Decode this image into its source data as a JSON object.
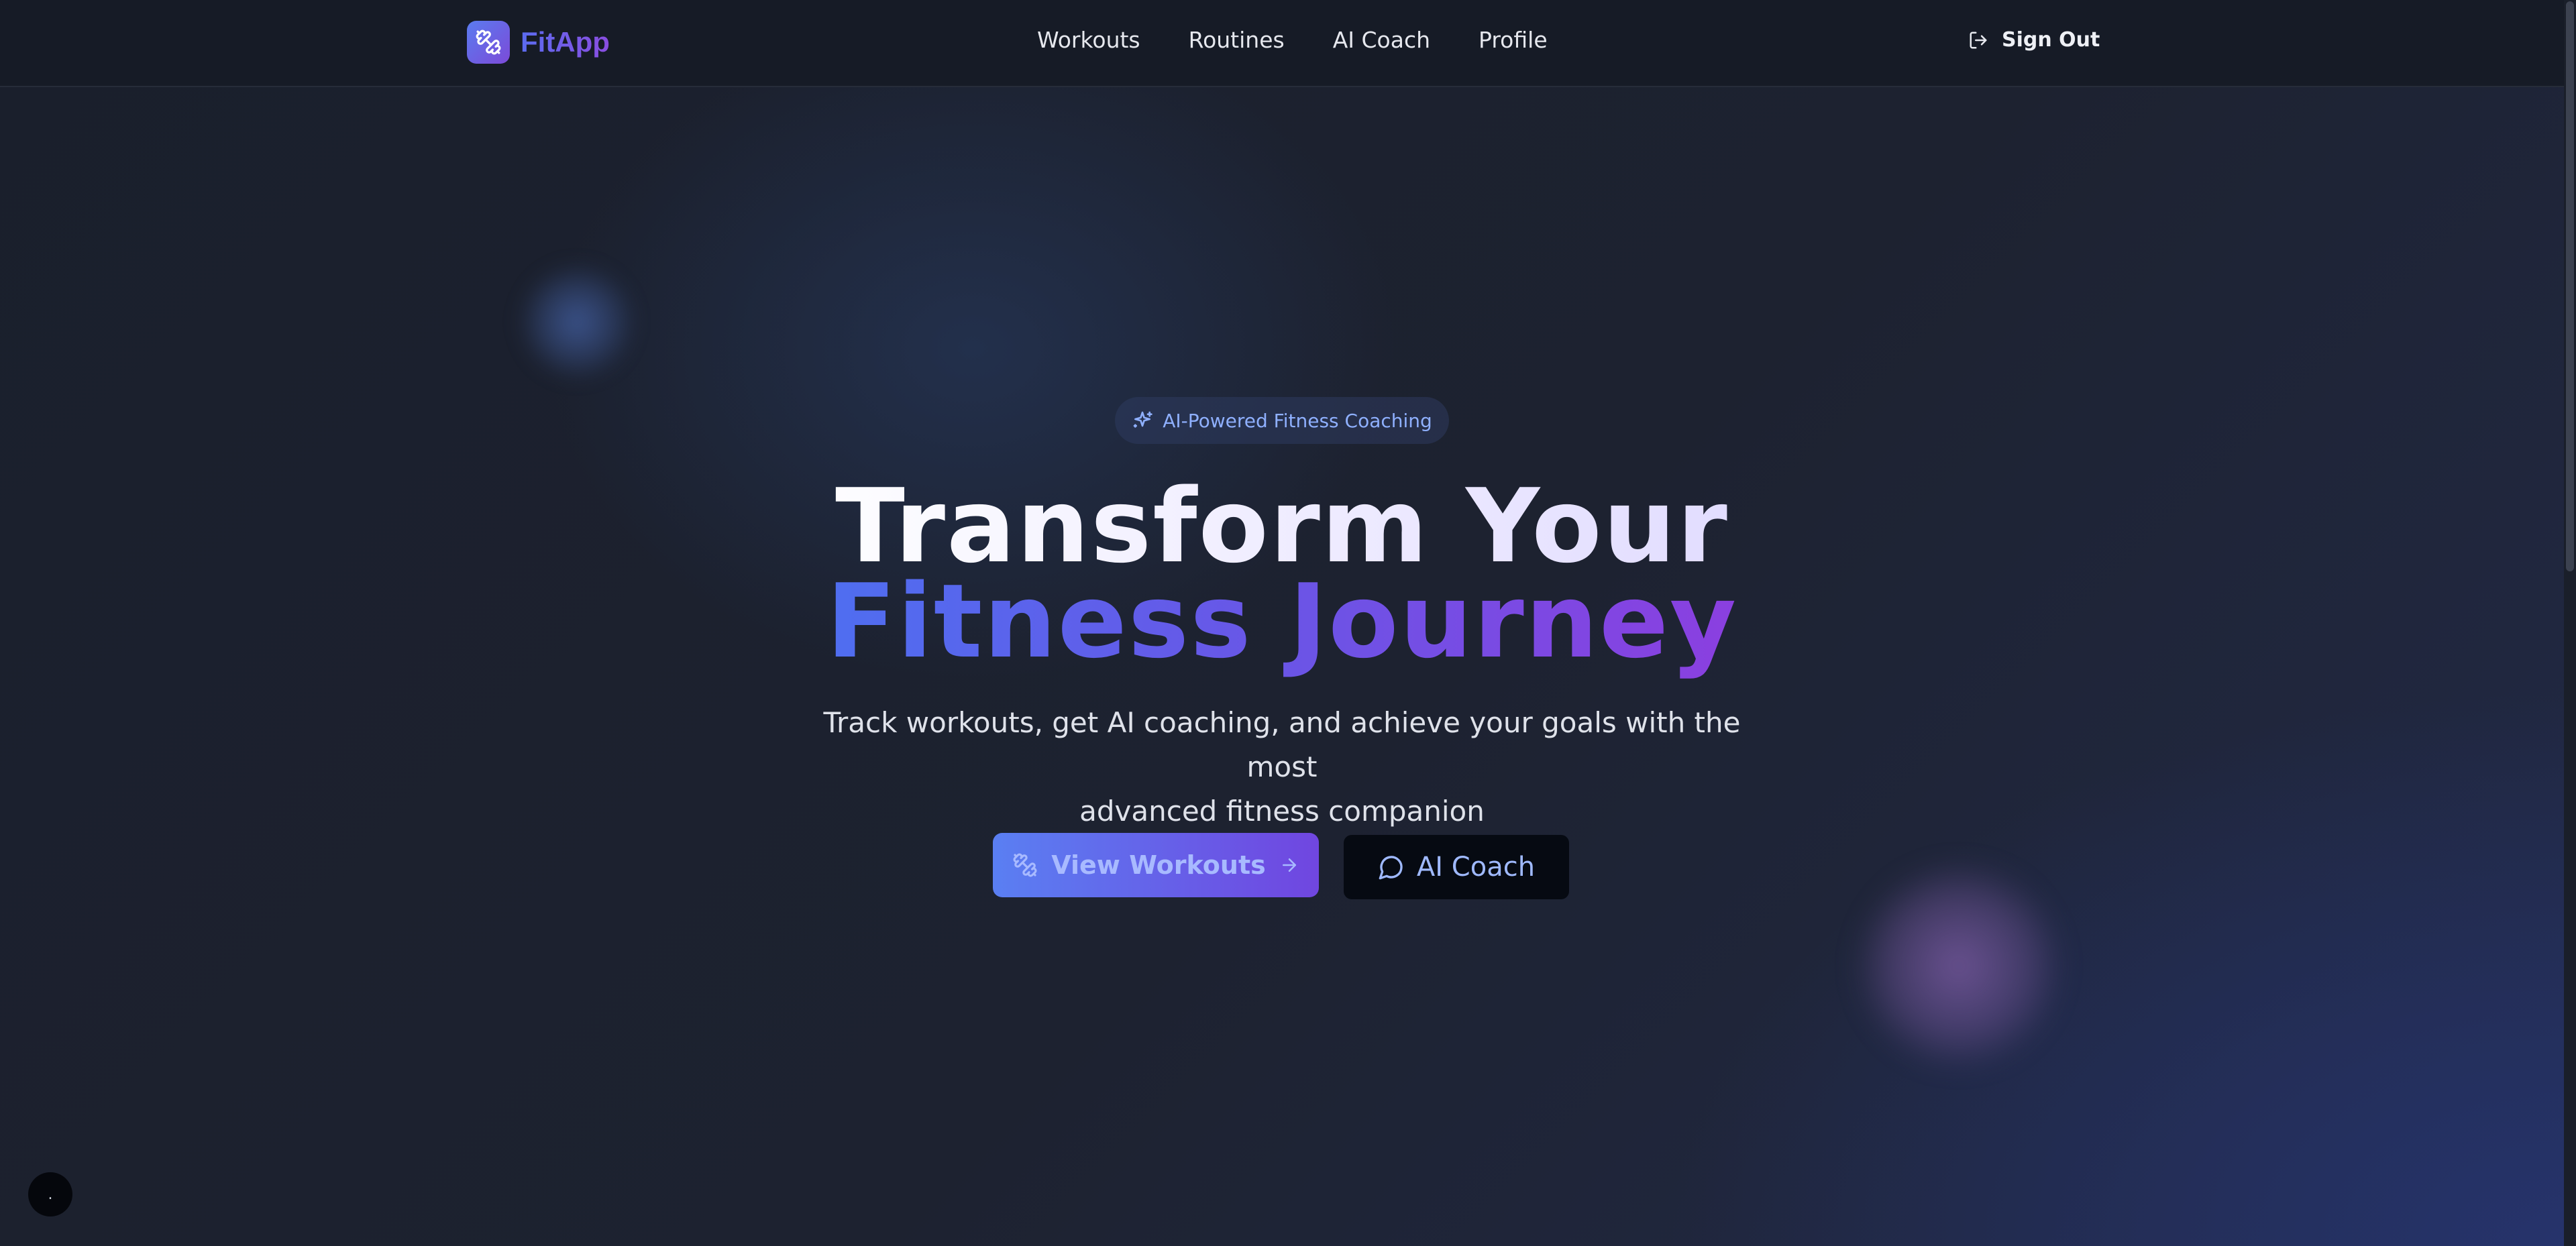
{
  "app": {
    "name": "FitApp"
  },
  "nav": {
    "items": [
      {
        "label": "Workouts"
      },
      {
        "label": "Routines"
      },
      {
        "label": "AI Coach"
      },
      {
        "label": "Profile"
      }
    ],
    "sign_out_label": "Sign Out"
  },
  "hero": {
    "badge": "AI-Powered Fitness Coaching",
    "title_line1": "Transform Your",
    "title_line2": "Fitness Journey",
    "subtitle_line1": "Track workouts, get AI coaching, and achieve your goals with the most",
    "subtitle_line2": "advanced fitness companion",
    "primary_button": "View Workouts",
    "secondary_button": "AI Coach"
  },
  "floating_button": {
    "label": "."
  },
  "icons": {
    "logo": "dumbbell-icon",
    "sign_out": "log-out-icon",
    "badge": "sparkles-icon",
    "primary_button": "dumbbell-icon",
    "primary_arrow": "arrow-right-icon",
    "secondary_button": "message-circle-icon"
  },
  "colors": {
    "background": "#1c2130",
    "header": "#161b26",
    "accent_blue": "#5a7ff2",
    "accent_purple": "#8b3fe0"
  }
}
